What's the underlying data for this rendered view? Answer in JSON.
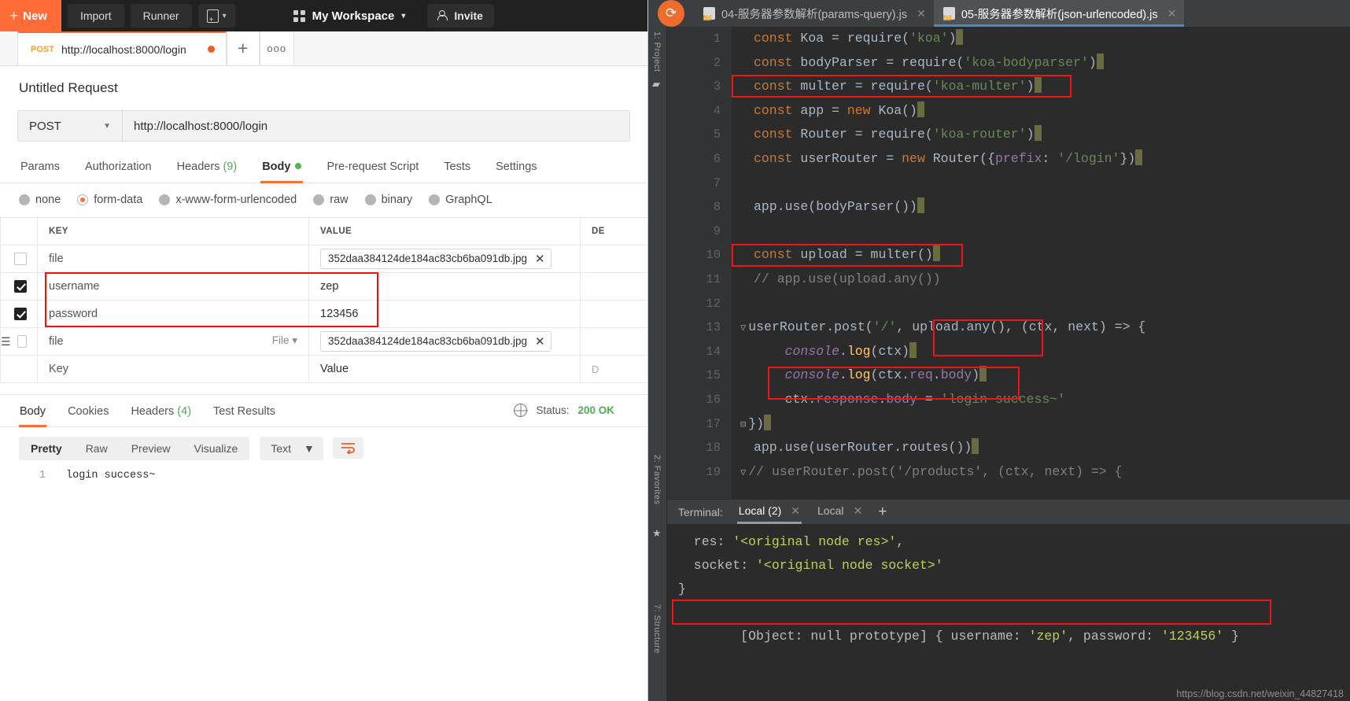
{
  "postman": {
    "topbar": {
      "new_label": "New",
      "import_label": "Import",
      "runner_label": "Runner",
      "workspace_label": "My Workspace",
      "invite_label": "Invite"
    },
    "tabs": [
      {
        "method": "POST",
        "url": "http://localhost:8000/login",
        "unsaved": true
      }
    ],
    "tab_add_label": "+",
    "tab_more_label": "ooo",
    "request_name": "Untitled Request",
    "method": "POST",
    "url": "http://localhost:8000/login",
    "request_tabs": [
      {
        "label": "Params",
        "active": false
      },
      {
        "label": "Authorization",
        "active": false
      },
      {
        "label": "Headers",
        "count": "(9)",
        "active": false
      },
      {
        "label": "Body",
        "active": true,
        "dot": true
      },
      {
        "label": "Pre-request Script",
        "active": false
      },
      {
        "label": "Tests",
        "active": false
      },
      {
        "label": "Settings",
        "active": false
      }
    ],
    "body_types": [
      {
        "label": "none",
        "selected": false
      },
      {
        "label": "form-data",
        "selected": true
      },
      {
        "label": "x-www-form-urlencoded",
        "selected": false
      },
      {
        "label": "raw",
        "selected": false
      },
      {
        "label": "binary",
        "selected": false
      },
      {
        "label": "GraphQL",
        "selected": false
      }
    ],
    "table": {
      "headers": {
        "key": "KEY",
        "value": "VALUE",
        "description": "DE"
      },
      "rows": [
        {
          "checked": false,
          "key": "file",
          "key_placeholder": true,
          "type": "",
          "value": "352daa384124de184ac83cb6ba091db.jpg",
          "value_is_file": true
        },
        {
          "checked": true,
          "key": "username",
          "key_placeholder": false,
          "type": "",
          "value": "zep",
          "value_is_file": false
        },
        {
          "checked": true,
          "key": "password",
          "key_placeholder": false,
          "type": "",
          "value": "123456",
          "value_is_file": false
        },
        {
          "checked": false,
          "key": "file",
          "key_placeholder": true,
          "type": "File",
          "value": "352daa384124de184ac83cb6ba091db.jpg",
          "value_is_file": true,
          "draggable": true
        },
        {
          "checked": false,
          "key": "Key",
          "key_placeholder": true,
          "type": "",
          "value": "Value",
          "value_is_file": false,
          "empty": true
        }
      ]
    },
    "response": {
      "tabs": [
        {
          "label": "Body",
          "active": true
        },
        {
          "label": "Cookies",
          "active": false
        },
        {
          "label": "Headers",
          "count": "(4)",
          "active": false
        },
        {
          "label": "Test Results",
          "active": false
        }
      ],
      "status_label": "Status:",
      "status_value": "200 OK",
      "view_modes": [
        {
          "label": "Pretty",
          "active": true
        },
        {
          "label": "Raw",
          "active": false
        },
        {
          "label": "Preview",
          "active": false
        },
        {
          "label": "Visualize",
          "active": false
        }
      ],
      "format": "Text",
      "body_line_number": "1",
      "body_text": "login success~"
    }
  },
  "ide": {
    "tabs": [
      {
        "label": "04-服务器参数解析(params-query).js",
        "active": false
      },
      {
        "label": "05-服务器参数解析(json-urlencoded).js",
        "active": true
      }
    ],
    "rails": {
      "left_top": "1: Project",
      "left_mid": "2: Favorites",
      "left_bottom": "7: Structure"
    },
    "code_lines": [
      {
        "n": "1",
        "tokens": [
          {
            "t": "const ",
            "c": "kw"
          },
          {
            "t": "Koa ",
            "c": "id"
          },
          {
            "t": "= ",
            "c": "pun"
          },
          {
            "t": "require(",
            "c": "id"
          },
          {
            "t": "'koa'",
            "c": "str"
          },
          {
            "t": ")",
            "c": "pun"
          }
        ],
        "caret": true
      },
      {
        "n": "2",
        "tokens": [
          {
            "t": "const ",
            "c": "kw"
          },
          {
            "t": "bodyParser ",
            "c": "id"
          },
          {
            "t": "= ",
            "c": "pun"
          },
          {
            "t": "require(",
            "c": "id"
          },
          {
            "t": "'koa-bodyparser'",
            "c": "str"
          },
          {
            "t": ")",
            "c": "pun"
          }
        ],
        "caret": true
      },
      {
        "n": "3",
        "tokens": [
          {
            "t": "const ",
            "c": "kw"
          },
          {
            "t": "multer ",
            "c": "id"
          },
          {
            "t": "= ",
            "c": "pun"
          },
          {
            "t": "require(",
            "c": "id"
          },
          {
            "t": "'koa-multer'",
            "c": "str"
          },
          {
            "t": ")",
            "c": "pun"
          }
        ],
        "caret": true
      },
      {
        "n": "4",
        "tokens": [
          {
            "t": "const ",
            "c": "kw"
          },
          {
            "t": "app ",
            "c": "id"
          },
          {
            "t": "= ",
            "c": "pun"
          },
          {
            "t": "new ",
            "c": "kw"
          },
          {
            "t": "Koa()",
            "c": "id"
          }
        ],
        "caret": true
      },
      {
        "n": "5",
        "tokens": [
          {
            "t": "const ",
            "c": "kw"
          },
          {
            "t": "Router ",
            "c": "id"
          },
          {
            "t": "= ",
            "c": "pun"
          },
          {
            "t": "require(",
            "c": "id"
          },
          {
            "t": "'koa-router'",
            "c": "str"
          },
          {
            "t": ")",
            "c": "pun"
          }
        ],
        "caret": true
      },
      {
        "n": "6",
        "tokens": [
          {
            "t": "const ",
            "c": "kw"
          },
          {
            "t": "userRouter ",
            "c": "id"
          },
          {
            "t": "= ",
            "c": "pun"
          },
          {
            "t": "new ",
            "c": "kw"
          },
          {
            "t": "Router({",
            "c": "id"
          },
          {
            "t": "prefix",
            "c": "prop"
          },
          {
            "t": ": ",
            "c": "pun"
          },
          {
            "t": "'/login'",
            "c": "str"
          },
          {
            "t": "})",
            "c": "pun"
          }
        ],
        "caret": true
      },
      {
        "n": "7",
        "tokens": [],
        "caret": false
      },
      {
        "n": "8",
        "tokens": [
          {
            "t": "app.use(bodyParser())",
            "c": "id"
          }
        ],
        "caret": true
      },
      {
        "n": "9",
        "tokens": [],
        "caret": false
      },
      {
        "n": "10",
        "tokens": [
          {
            "t": "const ",
            "c": "kw"
          },
          {
            "t": "upload ",
            "c": "id"
          },
          {
            "t": "= ",
            "c": "pun"
          },
          {
            "t": "multer()",
            "c": "id"
          }
        ],
        "caret": true
      },
      {
        "n": "11",
        "tokens": [
          {
            "t": "// app.use(upload.any())",
            "c": "com"
          }
        ],
        "caret": false
      },
      {
        "n": "12",
        "tokens": [],
        "caret": false
      },
      {
        "n": "13",
        "tokens": [
          {
            "t": "userRouter.post(",
            "c": "id"
          },
          {
            "t": "'/'",
            "c": "str"
          },
          {
            "t": ", ",
            "c": "pun"
          },
          {
            "t": "upload.any()",
            "c": "id"
          },
          {
            "t": ", (",
            "c": "pun"
          },
          {
            "t": "ctx",
            "c": "id"
          },
          {
            "t": ", ",
            "c": "pun"
          },
          {
            "t": "next",
            "c": "id"
          },
          {
            "t": ") => {",
            "c": "pun"
          }
        ],
        "caret": false,
        "fold": "▽"
      },
      {
        "n": "14",
        "tokens": [
          {
            "t": "    ",
            "c": "pun"
          },
          {
            "t": "console",
            "c": "cls"
          },
          {
            "t": ".",
            "c": "pun"
          },
          {
            "t": "log",
            "c": "fn"
          },
          {
            "t": "(ctx)",
            "c": "id"
          }
        ],
        "caret": true
      },
      {
        "n": "15",
        "tokens": [
          {
            "t": "    ",
            "c": "pun"
          },
          {
            "t": "console",
            "c": "cls"
          },
          {
            "t": ".",
            "c": "pun"
          },
          {
            "t": "log",
            "c": "fn"
          },
          {
            "t": "(ctx.",
            "c": "id"
          },
          {
            "t": "req",
            "c": "prop"
          },
          {
            "t": ".",
            "c": "pun"
          },
          {
            "t": "body",
            "c": "prop"
          },
          {
            "t": ")",
            "c": "id"
          }
        ],
        "caret": true
      },
      {
        "n": "16",
        "tokens": [
          {
            "t": "    ",
            "c": "pun"
          },
          {
            "t": "ctx.",
            "c": "id"
          },
          {
            "t": "response",
            "c": "prop"
          },
          {
            "t": ".",
            "c": "pun"
          },
          {
            "t": "body",
            "c": "prop"
          },
          {
            "t": " = ",
            "c": "pun"
          },
          {
            "t": "'login success~'",
            "c": "str"
          }
        ],
        "caret": false
      },
      {
        "n": "17",
        "tokens": [
          {
            "t": "})",
            "c": "pun"
          }
        ],
        "caret": true,
        "fold": "⊟"
      },
      {
        "n": "18",
        "tokens": [
          {
            "t": "app.use(userRouter.routes())",
            "c": "id"
          }
        ],
        "caret": true
      },
      {
        "n": "19",
        "tokens": [
          {
            "t": "// userRouter.post('/products', (ctx, next) => {",
            "c": "com"
          }
        ],
        "caret": false,
        "fold": "▽"
      }
    ],
    "terminal": {
      "label": "Terminal:",
      "tabs": [
        {
          "label": "Local (2)",
          "active": true
        },
        {
          "label": "Local",
          "active": false
        }
      ],
      "add_label": "+",
      "lines": [
        {
          "plain": "  res: ",
          "green": "'<original node res>'",
          "tail": ","
        },
        {
          "plain": "  socket: ",
          "green": "'<original node socket>'",
          "tail": ""
        },
        {
          "plain": "}",
          "green": "",
          "tail": ""
        },
        {
          "plain": "[Object: null prototype] { username: ",
          "green": "'zep'",
          "tail": ", password: "
        }
      ],
      "last_line_green2": "'123456'",
      "last_line_tail2": " }"
    },
    "watermark": "https://blog.csdn.net/weixin_44827418"
  }
}
